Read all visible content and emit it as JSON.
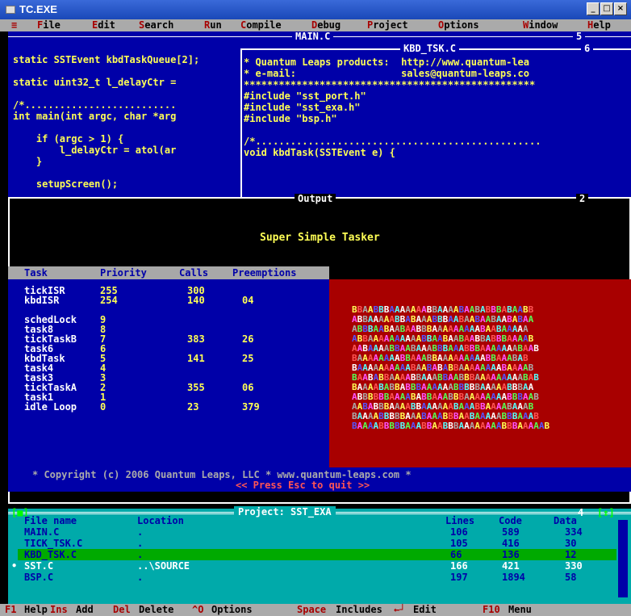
{
  "window": {
    "title": "TC.EXE",
    "minimize": "_",
    "maximize": "□",
    "close": "×"
  },
  "menu": [
    "≡",
    "File",
    "Edit",
    "Search",
    "Run",
    "Compile",
    "Debug",
    "Project",
    "Options",
    "Window",
    "Help"
  ],
  "editor": {
    "title": "MAIN.C",
    "number": "5",
    "lines": [
      "static SSTEvent kbdTaskQueue[2];",
      "",
      "static uint32_t l_delayCtr =",
      "",
      "/*..........................",
      "int main(int argc, char *arg",
      "",
      "    if (argc > 1) {",
      "        l_delayCtr = atol(ar",
      "    }",
      "",
      "    setupScreen();"
    ]
  },
  "kbd_window": {
    "title": "KBD_TSK.C",
    "number": "6",
    "lines": [
      "* Quantum Leaps products:  http://www.quantum-lea",
      "* e-mail:                  sales@quantum-leaps.co",
      "**************************************************",
      "#include \"sst_port.h\"",
      "#include \"sst_exa.h\"",
      "#include \"bsp.h\"",
      "",
      "/*.................................................",
      "void kbdTask(SSTEvent e) {"
    ]
  },
  "output": {
    "title": "Output",
    "number": "2",
    "heading": "Super Simple Tasker",
    "columns": [
      "Task",
      "Priority",
      "Calls",
      "Preemptions"
    ],
    "rows": [
      [
        "tickISR",
        "255",
        "300",
        ""
      ],
      [
        "kbdISR",
        "254",
        "140",
        "04"
      ],
      [
        "",
        "",
        "",
        ""
      ],
      [
        "schedLock",
        "9",
        "",
        ""
      ],
      [
        "task8",
        "8",
        "",
        ""
      ],
      [
        "tickTaskB",
        "7",
        "383",
        "26"
      ],
      [
        "task6",
        "6",
        "",
        ""
      ],
      [
        "kbdTask",
        "5",
        "141",
        "25"
      ],
      [
        "task4",
        "4",
        "",
        ""
      ],
      [
        "task3",
        "3",
        "",
        ""
      ],
      [
        "tickTaskA",
        "2",
        "355",
        "06"
      ],
      [
        "task1",
        "1",
        "",
        ""
      ],
      [
        "idle Loop",
        "0",
        "23",
        "379"
      ]
    ],
    "grid_rows": [
      "BBAABBBAAAAAAABBAAAABAABABBBABAABB",
      "ABBAAAAABBABAAABBBAABAABAABAABABAA",
      "ABBBAABAABAABBBAAAAAAAAABAABAAAAA",
      "ABBAAAAAAAAAABBAABAABAABBABBBAAAAB",
      "AABAAAABBAABAAABBBAAABBBAAAAAAABAAB",
      "BAAAAAAAABBAAABBAAAAAAAAABBAAABAB",
      "BAAAAAAAAAABAABABABBAAAAAAAABAAAAB",
      "BAABABBAAAABBAAABBAABBBAAAAAAAAABAB",
      "BAAAABABBABBBAAAAAABBBBBAAAAABBBAA",
      "ABBBBBBAAAABABBAAABBBAAAAAAAABBBAAB",
      "AABABBBAAAABBAAAAAABAAABBAAAABAAAB",
      "BAAAABBBBBAAABAAABBBAABAAAAABBBAAAB",
      "BAAAABBBBBAAABBAABBBAAAAAAAABBBAAAAAB"
    ],
    "copyright": "* Copyright (c) 2006 Quantum Leaps, LLC * www.quantum-leaps.com *",
    "press_esc": "<< Press Esc to quit >>"
  },
  "project": {
    "title": "Project: SST_EXA",
    "number": "4",
    "columns": [
      "File name",
      "Location",
      "Lines",
      "Code",
      "Data"
    ],
    "rows": [
      {
        "name": "MAIN.C",
        "location": ".",
        "lines": "106",
        "code": "589",
        "data": "334"
      },
      {
        "name": "TICK_TSK.C",
        "location": ".",
        "lines": "105",
        "code": "416",
        "data": "30"
      },
      {
        "name": "KBD_TSK.C",
        "location": ".",
        "lines": "66",
        "code": "136",
        "data": "12"
      },
      {
        "name": "SST.C",
        "location": "..\\SOURCE",
        "lines": "166",
        "code": "421",
        "data": "330",
        "selected": true
      },
      {
        "name": "BSP.C",
        "location": ".",
        "lines": "197",
        "code": "1894",
        "data": "58"
      }
    ]
  },
  "status": [
    {
      "key": "F1",
      "label": "Help"
    },
    {
      "key": "Ins",
      "label": "Add"
    },
    {
      "key": "Del",
      "label": "Delete"
    },
    {
      "key": "^O",
      "label": "Options"
    },
    {
      "key": "Space",
      "label": "Includes"
    },
    {
      "key": "←┘",
      "label": "Edit"
    },
    {
      "key": "F10",
      "label": "Menu"
    }
  ],
  "colors": {
    "dos_blue": "#0000a8",
    "dos_red": "#a80000",
    "dos_cyan": "#00aaaa",
    "dos_gray": "#aaaaaa",
    "yellow": "#ffff55",
    "green": "#00aa00"
  }
}
